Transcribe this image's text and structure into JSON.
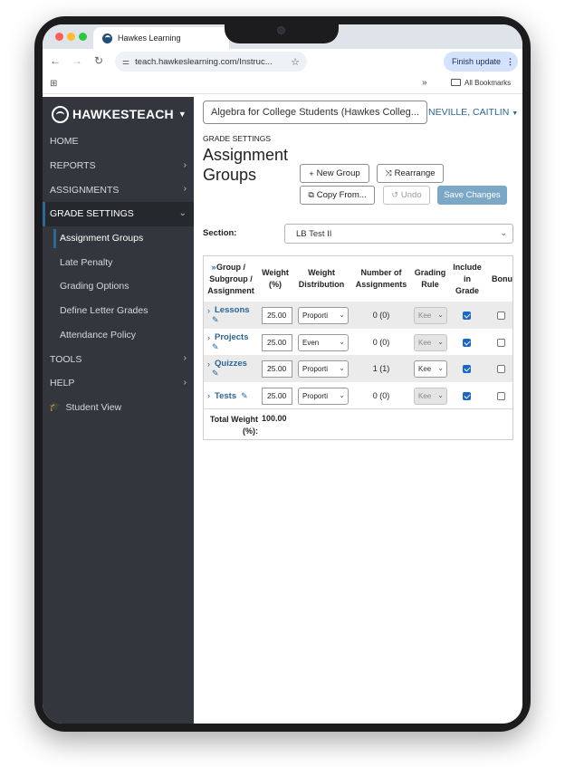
{
  "browser": {
    "tab_title": "Hawkes Learning",
    "url": "teach.hawkeslearning.com/Instruc...",
    "finish_update": "Finish update",
    "all_bookmarks": "All Bookmarks",
    "overflow": "»"
  },
  "sidebar": {
    "brand": "HAWKESTEACH",
    "items": [
      {
        "label": "HOME",
        "arrow": false
      },
      {
        "label": "REPORTS",
        "arrow": true
      },
      {
        "label": "ASSIGNMENTS",
        "arrow": true
      },
      {
        "label": "GRADE SETTINGS",
        "arrow": true,
        "active": true
      }
    ],
    "sub_items": [
      {
        "label": "Assignment Groups",
        "selected": true
      },
      {
        "label": "Late Penalty"
      },
      {
        "label": "Grading Options"
      },
      {
        "label": "Define Letter Grades"
      },
      {
        "label": "Attendance Policy"
      }
    ],
    "bottom_items": [
      {
        "label": "TOOLS"
      },
      {
        "label": "HELP"
      }
    ],
    "student_view": "Student View"
  },
  "header": {
    "course": "Algebra for College Students (Hawkes Colleg...",
    "user": "NEVILLE, CAITLIN"
  },
  "page": {
    "kicker": "GRADE SETTINGS",
    "title": "Assignment Groups",
    "buttons": {
      "new_group": "New Group",
      "rearrange": "Rearrange",
      "copy_from": "Copy From...",
      "undo": "Undo",
      "save": "Save Changes"
    },
    "section_label": "Section:",
    "section_value": "LB Test II"
  },
  "table": {
    "headers": {
      "group": "Group / Subgroup / Assignment",
      "weight": "Weight (%)",
      "distribution": "Weight Distribution",
      "count": "Number of Assignments",
      "rule": "Grading Rule",
      "include": "Include in Grade",
      "bonus": "Bonus"
    },
    "rows": [
      {
        "name": "Lessons",
        "weight": "25.00",
        "distribution": "Proporti",
        "count": "0 (0)",
        "rule": "Kee",
        "rule_enabled": false,
        "include": true,
        "bonus": false
      },
      {
        "name": "Projects",
        "weight": "25.00",
        "distribution": "Even",
        "count": "0 (0)",
        "rule": "Kee",
        "rule_enabled": false,
        "include": true,
        "bonus": false
      },
      {
        "name": "Quizzes",
        "weight": "25.00",
        "distribution": "Proporti",
        "count": "1 (1)",
        "rule": "Kee",
        "rule_enabled": true,
        "include": true,
        "bonus": false
      },
      {
        "name": "Tests",
        "weight": "25.00",
        "distribution": "Proporti",
        "count": "0 (0)",
        "rule": "Kee",
        "rule_enabled": false,
        "include": true,
        "bonus": false
      }
    ],
    "total_label": "Total Weight (%):",
    "total_value": "100.00"
  }
}
